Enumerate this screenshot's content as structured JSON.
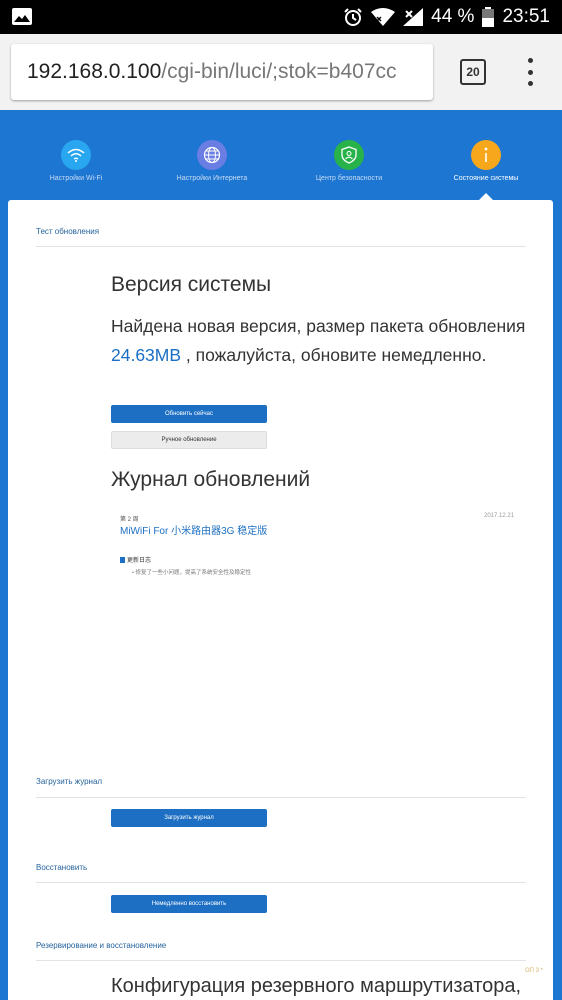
{
  "status_bar": {
    "battery": "44 %",
    "time": "23:51"
  },
  "browser": {
    "url_host": "192.168.0.100",
    "url_path": "/cgi-bin/luci/;stok=b407cc",
    "tab_count": "20"
  },
  "nav": {
    "items": [
      {
        "label": "Настройки Wi-Fi",
        "icon": "wifi-icon",
        "color": "#29a6f0"
      },
      {
        "label": "Настройки Интернета",
        "icon": "globe-icon",
        "color": "#6a7de3"
      },
      {
        "label": "Центр безопасности",
        "icon": "shield-icon",
        "color": "#28b34a"
      },
      {
        "label": "Состояние системы",
        "icon": "info-icon",
        "color": "#f6a71b"
      }
    ],
    "active_index": 3
  },
  "update_test": {
    "section_title": "Тест обновления",
    "heading": "Версия системы",
    "message_before": "Найдена новая версия, размер пакета обновления ",
    "package_size": "24.63MB",
    "message_after": " , пожалуйста, обновите немедленно.",
    "update_now_label": "Обновить сейчас",
    "manual_update_label": "Ручное обновление"
  },
  "changelog": {
    "heading": "Журнал обновлений",
    "week": "第 2 周",
    "date": "2017.12.21",
    "title": "MiWiFi For 小米路由器3G 稳定版",
    "doc_label": "更新日志",
    "bullet": "•  修复了一些小问题，提高了系统安全性及稳定性"
  },
  "download_log": {
    "section_title": "Загрузить журнал",
    "button_label": "Загрузить журнал"
  },
  "restore": {
    "section_title": "Восстановить",
    "button_label": "Немедленно восстановить"
  },
  "backup": {
    "section_title": "Резервирование и восстановление",
    "heading": "Конфигурация резервного маршрутизатора,"
  },
  "watermark": "ОП 3 *"
}
